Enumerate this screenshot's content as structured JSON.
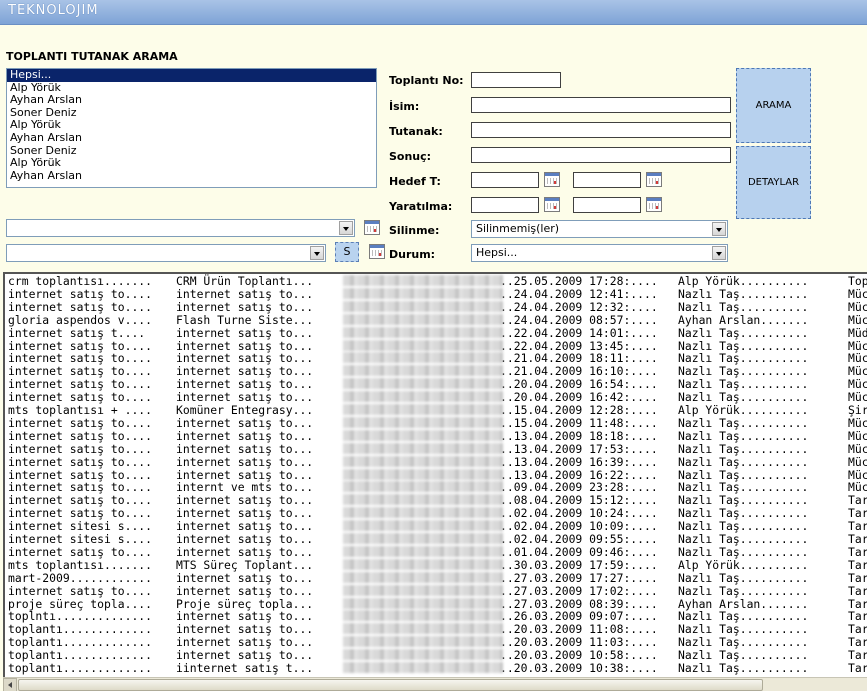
{
  "app": {
    "logo": "TEKNOLOJIM"
  },
  "search": {
    "title": "TOPLANTI TUTANAK ARAMA",
    "people": [
      "Hepsi...",
      "Alp Yörük",
      "Ayhan Arslan",
      "Soner Deniz",
      "Alp Yörük",
      "Ayhan Arslan",
      "Soner Deniz",
      "Alp Yörük",
      "Ayhan Arslan"
    ],
    "selected_person": "Hepsi...",
    "combo1_value": "",
    "combo2_value": "",
    "s_button": "S",
    "labels": {
      "meeting_no": "Toplantı No:",
      "name": "İsim:",
      "minutes": "Tutanak:",
      "result": "Sonuç:",
      "target_date": "Hedef T:",
      "created": "Yaratılma:",
      "deletion": "Silinme:",
      "status": "Durum:"
    },
    "deletion_value": "Silinmemiş(ler)",
    "status_value": "Hepsi...",
    "search_button": "ARAMA",
    "details_button": "DETAYLAR"
  },
  "results": [
    {
      "c1": "crm toplantısı.......",
      "c2": "CRM Ürün Toplantı...",
      "date": "..25.05.2009 17:28:....",
      "owner": "Alp Yörük..........",
      "tail": "Top"
    },
    {
      "c1": "internet satış to....",
      "c2": "internet satış to...",
      "date": "..24.04.2009 12:41:....",
      "owner": "Nazlı Taş..........",
      "tail": "Müc"
    },
    {
      "c1": "internet satış to....",
      "c2": "internet satış to...",
      "date": "..24.04.2009 12:32:....",
      "owner": "Nazlı Taş..........",
      "tail": "Müc"
    },
    {
      "c1": "gloria aspendos v....",
      "c2": "Flash Turne Siste...",
      "date": "..24.04.2009 08:57:....",
      "owner": "Ayhan Arslan.......",
      "tail": "Müc"
    },
    {
      "c1": "internet satış t....",
      "c2": "internet satış to...",
      "date": "..22.04.2009 14:01:....",
      "owner": "Nazlı Taş..........",
      "tail": "Müdv"
    },
    {
      "c1": "internet satış to....",
      "c2": "internet satış to...",
      "date": "..22.04.2009 13:45:....",
      "owner": "Nazlı Taş..........",
      "tail": "Müc"
    },
    {
      "c1": "internet satış to....",
      "c2": "internet satış to...",
      "date": "..21.04.2009 18:11:....",
      "owner": "Nazlı Taş..........",
      "tail": "Müc"
    },
    {
      "c1": "internet satış to....",
      "c2": "internet satış to...",
      "date": "..21.04.2009 16:10:....",
      "owner": "Nazlı Taş..........",
      "tail": "Müc"
    },
    {
      "c1": "internet satış to....",
      "c2": "internet satış to...",
      "date": "..20.04.2009 16:54:....",
      "owner": "Nazlı Taş..........",
      "tail": "Müc"
    },
    {
      "c1": "internet satış to....",
      "c2": "internet satış to...",
      "date": "..20.04.2009 16:42:....",
      "owner": "Nazlı Taş..........",
      "tail": "Müc"
    },
    {
      "c1": "mts toplantısı + ....",
      "c2": "Komüner Entegrasy...",
      "date": "..15.04.2009 12:28:....",
      "owner": "Alp Yörük..........",
      "tail": "Şir"
    },
    {
      "c1": "internet satış to....",
      "c2": "internet satış to...",
      "date": "..15.04.2009 11:48:....",
      "owner": "Nazlı Taş..........",
      "tail": "Müc"
    },
    {
      "c1": "internet satış to....",
      "c2": "internet satış to...",
      "date": "..13.04.2009 18:18:....",
      "owner": "Nazlı Taş..........",
      "tail": "Müc"
    },
    {
      "c1": "internet satış to....",
      "c2": "internet satış to...",
      "date": "..13.04.2009 17:53:....",
      "owner": "Nazlı Taş..........",
      "tail": "Müc"
    },
    {
      "c1": "internet satış to....",
      "c2": "internet satış to...",
      "date": "..13.04.2009 16:39:....",
      "owner": "Nazlı Taş..........",
      "tail": "Müc"
    },
    {
      "c1": "internet satış to....",
      "c2": "internet satış to...",
      "date": "..13.04.2009 16:22:....",
      "owner": "Nazlı Taş..........",
      "tail": "Müc"
    },
    {
      "c1": "internet satış to....",
      "c2": "internt ve mts to...",
      "date": "..09.04.2009 23:28:....",
      "owner": "Nazlı Taş..........",
      "tail": "Müc"
    },
    {
      "c1": "internet satış to....",
      "c2": "internet satış to...",
      "date": "..08.04.2009 15:12:....",
      "owner": "Nazlı Taş..........",
      "tail": "Tar"
    },
    {
      "c1": "internet satış to....",
      "c2": "internet satış to...",
      "date": "..02.04.2009 10:24:....",
      "owner": "Nazlı Taş..........",
      "tail": "Tar"
    },
    {
      "c1": "internet sitesi s....",
      "c2": "internet satış to...",
      "date": "..02.04.2009 10:09:....",
      "owner": "Nazlı Taş..........",
      "tail": "Tar"
    },
    {
      "c1": "internet sitesi s....",
      "c2": "internet satış to...",
      "date": "..02.04.2009 09:55:....",
      "owner": "Nazlı Taş..........",
      "tail": "Tar"
    },
    {
      "c1": "internet satış to....",
      "c2": "internet satış to...",
      "date": "..01.04.2009 09:46:....",
      "owner": "Nazlı Taş..........",
      "tail": "Tar"
    },
    {
      "c1": "mts toplantısı.......",
      "c2": "MTS Süreç Toplant...",
      "date": "..30.03.2009 17:59:....",
      "owner": "Alp Yörük..........",
      "tail": "Tar"
    },
    {
      "c1": "mart-2009............",
      "c2": "internet satış to...",
      "date": "..27.03.2009 17:27:....",
      "owner": "Nazlı Taş..........",
      "tail": "Tar"
    },
    {
      "c1": "internet satış to....",
      "c2": "internet satış to...",
      "date": "..27.03.2009 17:02:....",
      "owner": "Nazlı Taş..........",
      "tail": "Tar"
    },
    {
      "c1": "proje süreç topla....",
      "c2": "Proje süreç topla...",
      "date": "..27.03.2009 08:39:....",
      "owner": "Ayhan Arslan.......",
      "tail": "Tar"
    },
    {
      "c1": "toplntı..............",
      "c2": "internet satış to...",
      "date": "..26.03.2009 09:07:....",
      "owner": "Nazlı Taş..........",
      "tail": "Tar"
    },
    {
      "c1": "toplantı.............",
      "c2": "internet satış to...",
      "date": "..20.03.2009 11:08:....",
      "owner": "Nazlı Taş..........",
      "tail": "Tar"
    },
    {
      "c1": "toplantı.............",
      "c2": "internet satış to...",
      "date": "..20.03.2009 11:03:....",
      "owner": "Nazlı Taş..........",
      "tail": "Tar"
    },
    {
      "c1": "toplantı.............",
      "c2": "internet satış to...",
      "date": "..20.03.2009 10:58:....",
      "owner": "Nazlı Taş..........",
      "tail": "Tar"
    },
    {
      "c1": "toplantı.............",
      "c2": "iinternet satış t...",
      "date": "..20.03.2009 10:38:....",
      "owner": "Nazlı Taş..........",
      "tail": "Tar"
    }
  ]
}
